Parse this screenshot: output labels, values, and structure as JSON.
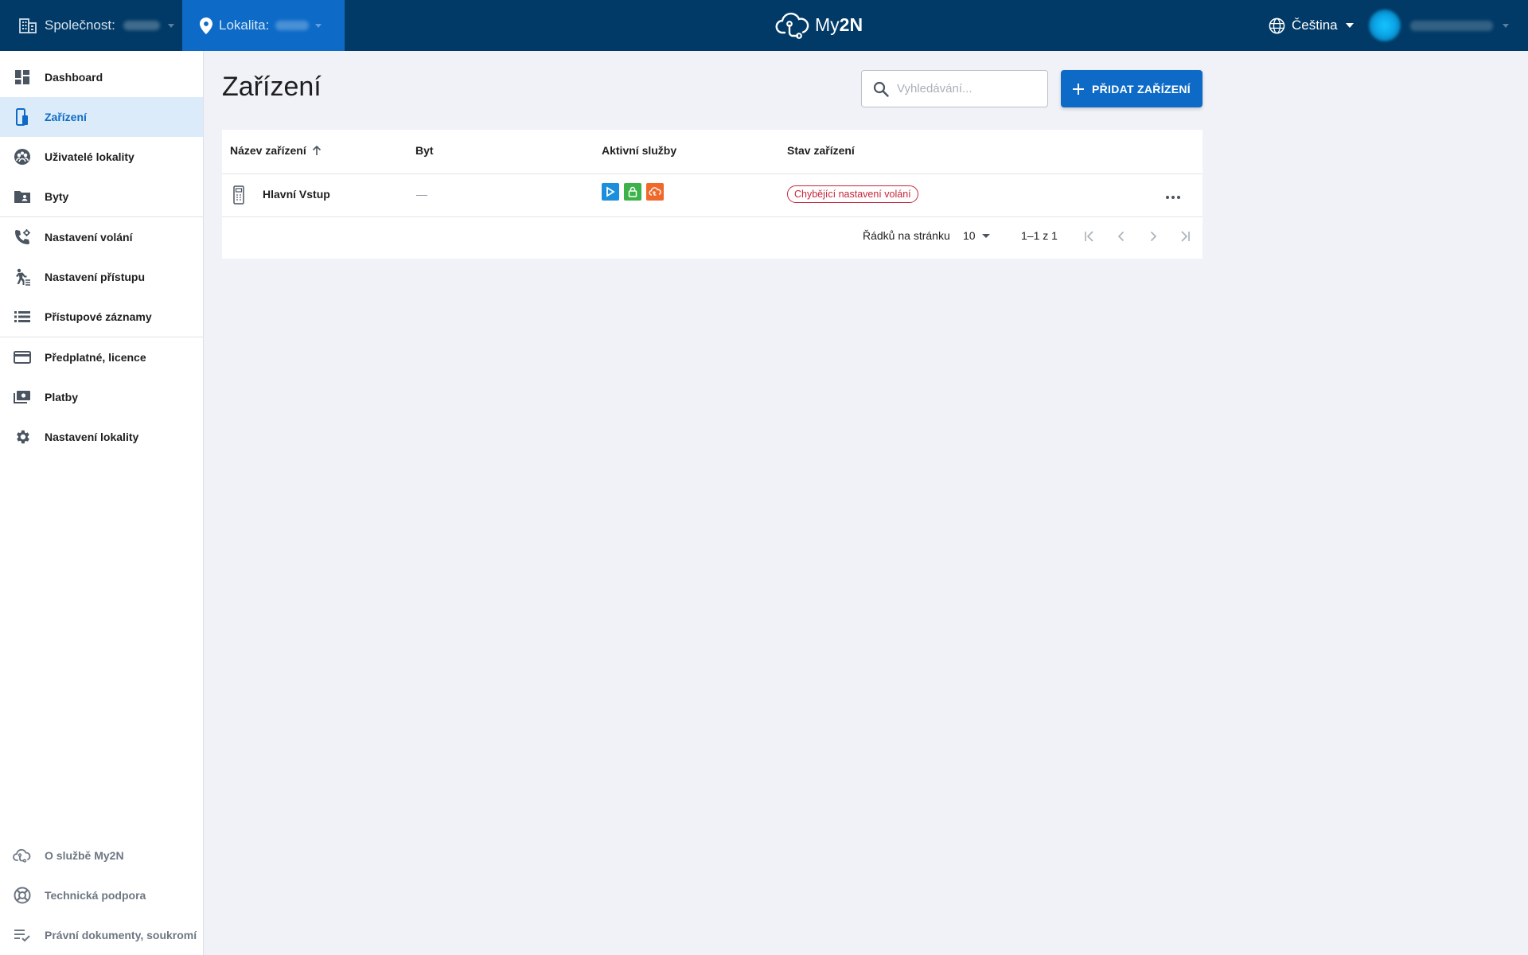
{
  "topbar": {
    "company_label": "Společnost:",
    "site_label": "Lokalita:",
    "logo_text_light": "My",
    "logo_text_bold": "2N",
    "language": "Čeština"
  },
  "sidebar": {
    "items": [
      {
        "label": "Dashboard",
        "icon": "dashboard-icon"
      },
      {
        "label": "Zařízení",
        "icon": "device-icon"
      },
      {
        "label": "Uživatelé lokality",
        "icon": "users-icon"
      },
      {
        "label": "Byty",
        "icon": "apartments-icon"
      },
      {
        "label": "Nastavení volání",
        "icon": "phone-settings-icon"
      },
      {
        "label": "Nastavení přístupu",
        "icon": "access-icon"
      },
      {
        "label": "Přístupové záznamy",
        "icon": "list-icon"
      },
      {
        "label": "Předplatné, licence",
        "icon": "card-icon"
      },
      {
        "label": "Platby",
        "icon": "payments-icon"
      },
      {
        "label": "Nastavení lokality",
        "icon": "gear-icon"
      }
    ],
    "footer": [
      {
        "label": "O službě My2N",
        "icon": "cloud-icon"
      },
      {
        "label": "Technická podpora",
        "icon": "lifebuoy-icon"
      },
      {
        "label": "Právní dokumenty, soukromí",
        "icon": "document-check-icon"
      }
    ]
  },
  "main": {
    "title": "Zařízení",
    "search_placeholder": "Vyhledávání...",
    "add_button": "PŘIDAT ZAŘÍZENÍ"
  },
  "table": {
    "headers": [
      "Název zařízení",
      "Byt",
      "Aktivní služby",
      "Stav zařízení"
    ],
    "rows": [
      {
        "name": "Hlavní Vstup",
        "apartment": "—",
        "status": "Chybějící nastavení volání"
      }
    ],
    "service_colors": [
      "#1c8fdc",
      "#3bb34a",
      "#f0692b"
    ]
  },
  "pagination": {
    "rows_label": "Řádků na stránku",
    "rows_value": "10",
    "range": "1–1 z 1"
  }
}
